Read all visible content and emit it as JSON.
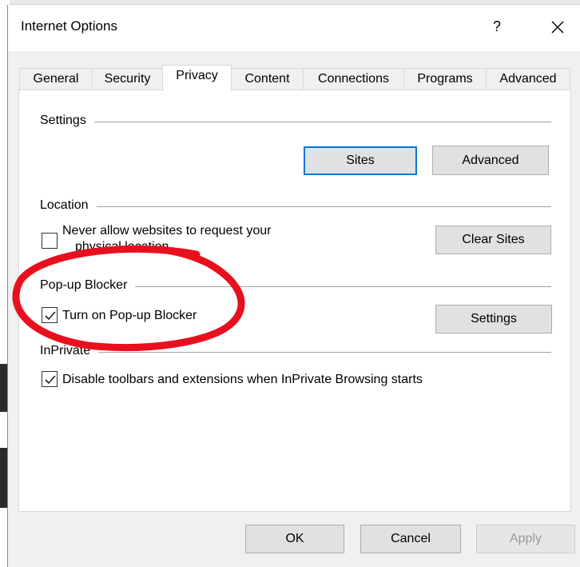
{
  "window": {
    "title": "Internet Options",
    "help_glyph": "?"
  },
  "tabs": [
    {
      "label": "General"
    },
    {
      "label": "Security"
    },
    {
      "label": "Privacy"
    },
    {
      "label": "Content"
    },
    {
      "label": "Connections"
    },
    {
      "label": "Programs"
    },
    {
      "label": "Advanced"
    }
  ],
  "active_tab": "Privacy",
  "settings": {
    "group_label": "Settings",
    "sites_button": "Sites",
    "advanced_button": "Advanced"
  },
  "location": {
    "group_label": "Location",
    "never_allow_line1": "Never allow websites to request your",
    "never_allow_line2": "physical location",
    "never_allow_checked": false,
    "clear_sites_button": "Clear Sites"
  },
  "popup": {
    "group_label": "Pop-up Blocker",
    "turn_on_label": "Turn on Pop-up Blocker",
    "turn_on_checked": true,
    "settings_button": "Settings"
  },
  "inprivate": {
    "group_label": "InPrivate",
    "disable_label": "Disable toolbars and extensions when InPrivate Browsing starts",
    "disable_checked": true
  },
  "footer": {
    "ok_button": "OK",
    "cancel_button": "Cancel",
    "apply_button": "Apply"
  },
  "colors": {
    "accent": "#0078d7",
    "annotation": "#e8101e",
    "window_bg": "#f0f0f0"
  }
}
